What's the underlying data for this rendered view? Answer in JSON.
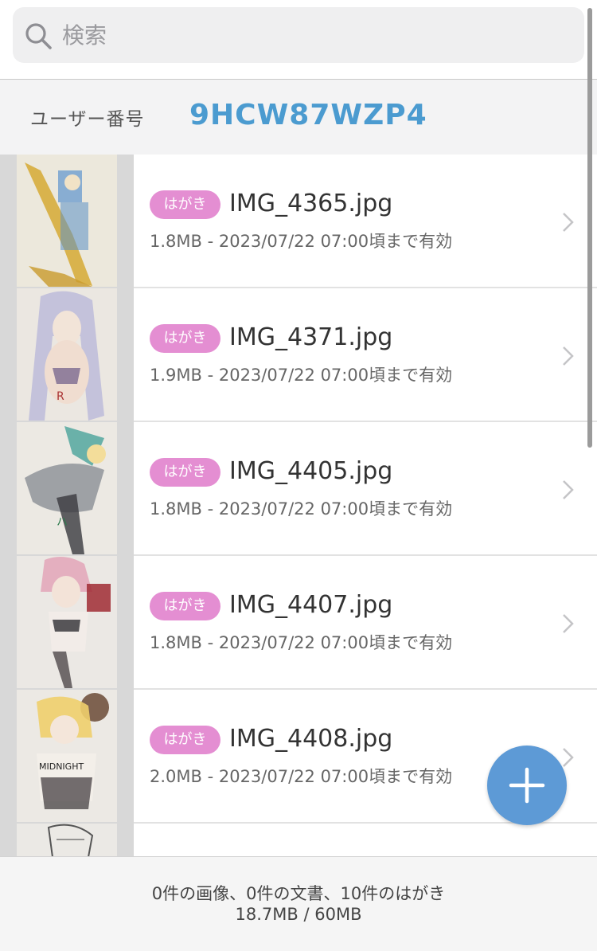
{
  "search": {
    "placeholder": "検索",
    "icon": "search-icon"
  },
  "user": {
    "label": "ユーザー番号",
    "id": "9HCW87WZP4",
    "id_color": "#4b9bd0"
  },
  "files": [
    {
      "badge": "はがき",
      "name": "IMG_4365.jpg",
      "meta": "1.8MB - 2023/07/22 07:00頃まで有効"
    },
    {
      "badge": "はがき",
      "name": "IMG_4371.jpg",
      "meta": "1.9MB - 2023/07/22 07:00頃まで有効"
    },
    {
      "badge": "はがき",
      "name": "IMG_4405.jpg",
      "meta": "1.8MB - 2023/07/22 07:00頃まで有効"
    },
    {
      "badge": "はがき",
      "name": "IMG_4407.jpg",
      "meta": "1.8MB - 2023/07/22 07:00頃まで有効"
    },
    {
      "badge": "はがき",
      "name": "IMG_4408.jpg",
      "meta": "2.0MB - 2023/07/22 07:00頃まで有効"
    }
  ],
  "badge_color": "#e48ed2",
  "fab": {
    "icon": "plus-icon",
    "color": "#5d9ad6"
  },
  "footer": {
    "counts": "0件の画像、0件の文書、10件のはがき",
    "storage": "18.7MB / 60MB"
  }
}
